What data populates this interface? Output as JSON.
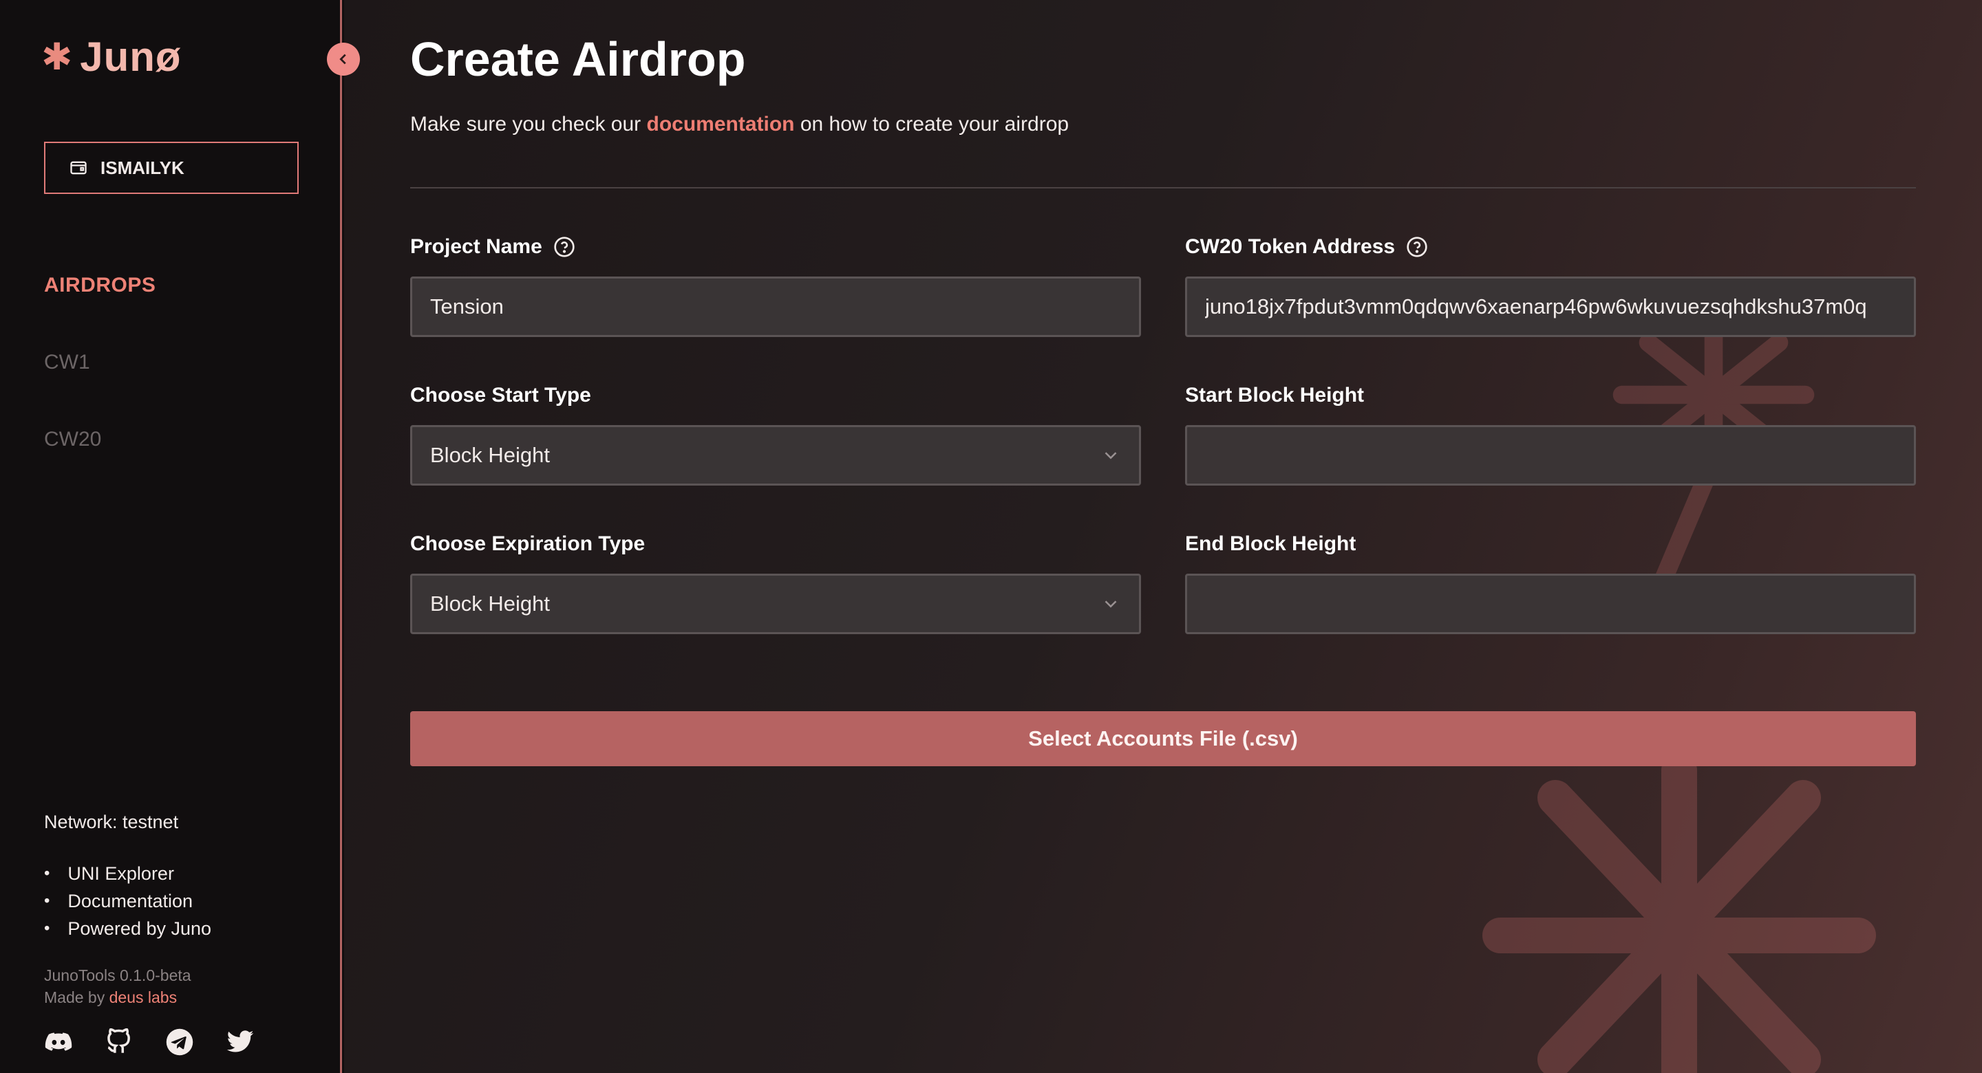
{
  "sidebar": {
    "logo": "Junø",
    "wallet_label": "ISMAILYK",
    "nav": [
      {
        "label": "AIRDROPS",
        "active": true
      },
      {
        "label": "CW1",
        "active": false
      },
      {
        "label": "CW20",
        "active": false
      }
    ],
    "network": "Network: testnet",
    "links": [
      "UNI Explorer",
      "Documentation",
      "Powered by Juno"
    ],
    "version": "JunoTools 0.1.0-beta",
    "made_by_prefix": "Made by",
    "made_by_link": "deus labs",
    "socials": [
      "discord-icon",
      "github-icon",
      "telegram-icon",
      "twitter-icon"
    ]
  },
  "main": {
    "title": "Create Airdrop",
    "subtitle_prefix": "Make sure you check our",
    "subtitle_link": "documentation",
    "subtitle_suffix": "on how to create your airdrop",
    "fields": {
      "project_name": {
        "label": "Project Name",
        "value": "Tension"
      },
      "token_address": {
        "label": "CW20 Token Address",
        "value": "juno18jx7fpdut3vmm0qdqwv6xaenarp46pw6wkuvuezsqhdkshu37m0q"
      },
      "start_type": {
        "label": "Choose Start Type",
        "value": "Block Height"
      },
      "start_height": {
        "label": "Start Block Height",
        "value": ""
      },
      "expiration_type": {
        "label": "Choose Expiration Type",
        "value": "Block Height"
      },
      "end_height": {
        "label": "End Block Height",
        "value": ""
      }
    },
    "csv_button": "Select Accounts File (.csv)"
  },
  "colors": {
    "accent": "#ee8276",
    "button": "#b66362",
    "sidebar_bg": "#110e0f"
  }
}
